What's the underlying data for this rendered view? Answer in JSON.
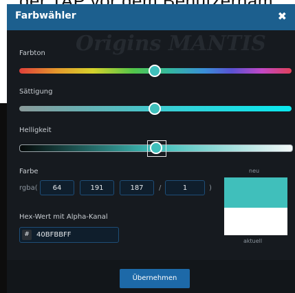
{
  "background": {
    "partial_text": "der TAP vor dem Benutzernam"
  },
  "dialog": {
    "title": "Farbwähler",
    "close_glyph": "✖",
    "watermark_text": "Origins MANTIS"
  },
  "sliders": {
    "hue_label": "Farbton",
    "hue_value": 0.5,
    "saturation_label": "Sättigung",
    "saturation_value": 0.5,
    "lightness_label": "Helligkeit",
    "lightness_value": 0.5
  },
  "color": {
    "label": "Farbe",
    "prefix": "rgba(",
    "r": "64",
    "g": "191",
    "b": "187",
    "slash": "/",
    "a": "1",
    "suffix": ")",
    "new_label": "neu",
    "current_label": "aktuell",
    "new_color": "#40bfbb",
    "current_color": "#ffffff"
  },
  "hex": {
    "label": "Hex-Wert mit Alpha-Kanal",
    "hash": "#",
    "value": "40BFBBFF"
  },
  "footer": {
    "apply_label": "Übernehmen"
  },
  "colors": {
    "titlebar": "#1c5f8e",
    "dialog_bg": "#161a1f",
    "accent_button": "#1d69a8"
  }
}
